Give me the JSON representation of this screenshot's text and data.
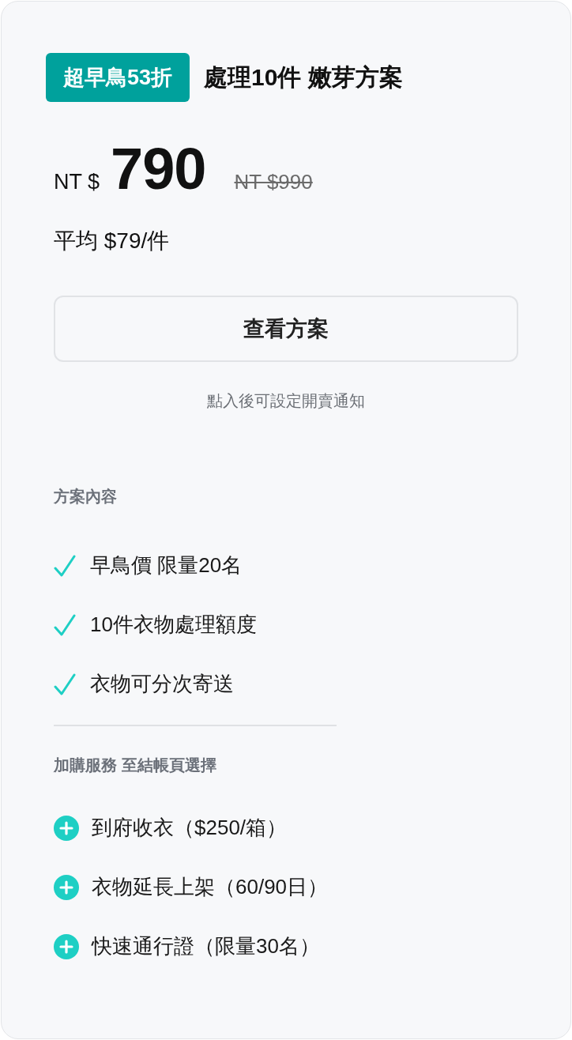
{
  "plan": {
    "badge": "超早鳥53折",
    "title": "處理10件 嫩芽方案",
    "currency": "NT $",
    "price": "790",
    "original_price": "NT $990",
    "average": "平均 $79/件"
  },
  "button": {
    "label": "查看方案"
  },
  "note": "點入後可設定開賣通知",
  "contents": {
    "heading": "方案內容",
    "items": [
      {
        "label": "早鳥價 限量20名"
      },
      {
        "label": "10件衣物處理額度"
      },
      {
        "label": "衣物可分次寄送"
      }
    ]
  },
  "addons": {
    "heading": "加購服務 至結帳頁選擇",
    "items": [
      {
        "label": "到府收衣（$250/箱）"
      },
      {
        "label": "衣物延長上架（60/90日）"
      },
      {
        "label": "快速通行證（限量30名）"
      }
    ]
  }
}
